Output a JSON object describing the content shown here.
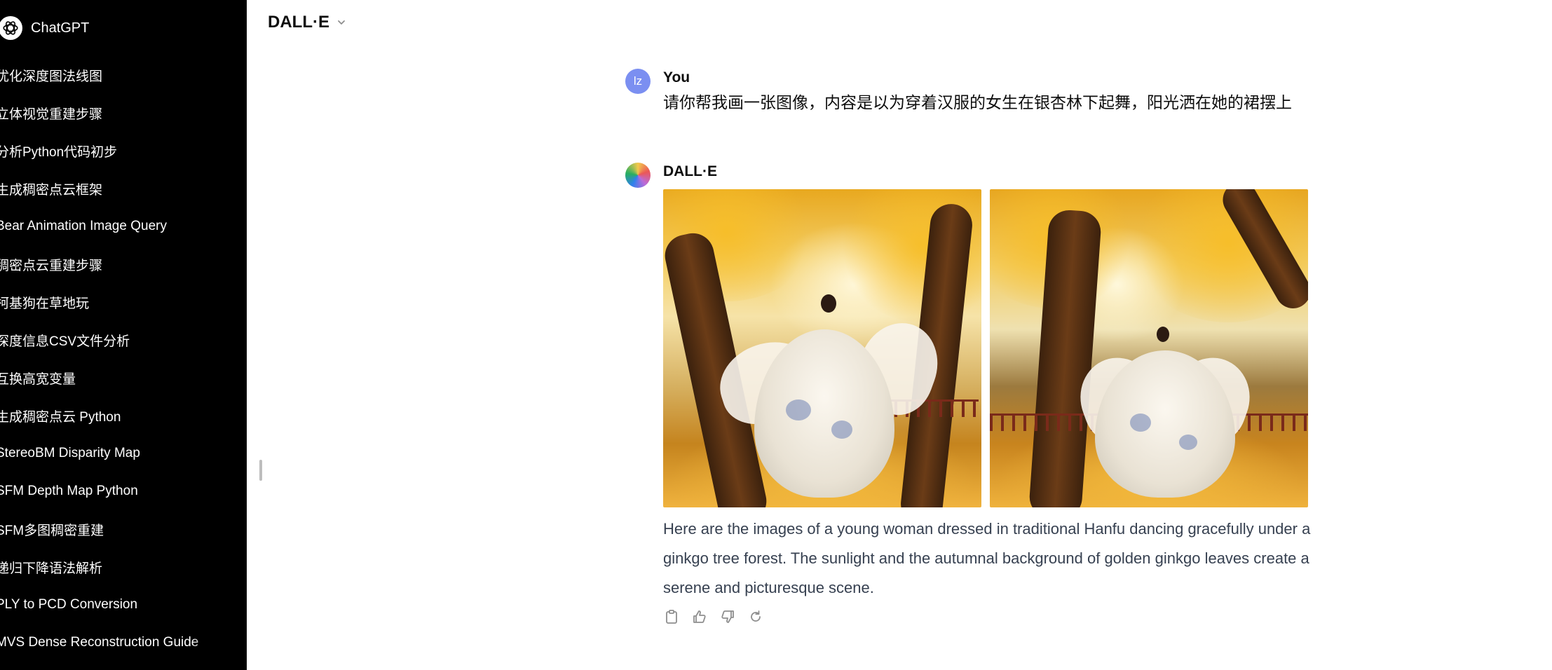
{
  "sidebar": {
    "brand": "ChatGPT",
    "history": [
      "优化深度图法线图",
      "立体视觉重建步骤",
      "分析Python代码初步",
      "生成稠密点云框架",
      "Bear Animation Image Query",
      "稠密点云重建步骤",
      "柯基狗在草地玩",
      "深度信息CSV文件分析",
      "互换高宽变量",
      "生成稠密点云 Python",
      "StereoBM Disparity Map",
      "SFM Depth Map Python",
      "SFM多图稠密重建",
      "递归下降语法解析",
      "PLY to PCD Conversion",
      "MVS Dense Reconstruction Guide"
    ]
  },
  "header": {
    "model": "DALL·E"
  },
  "thread": {
    "user": {
      "avatar_initials": "lz",
      "name": "You",
      "text": "请你帮我画一张图像，内容是以为穿着汉服的女生在银杏林下起舞，阳光洒在她的裙摆上"
    },
    "assistant": {
      "name": "DALL·E",
      "text": "Here are the images of a young woman dressed in traditional Hanfu dancing gracefully under a ginkgo tree forest. The sunlight and the autumnal background of golden ginkgo leaves create a serene and picturesque scene.",
      "images": [
        {
          "icon": "generated-image"
        },
        {
          "icon": "generated-image"
        }
      ],
      "actions": [
        "copy-icon",
        "thumbs-up-icon",
        "thumbs-down-icon",
        "regenerate-icon"
      ]
    }
  },
  "colors": {
    "sidebar_bg": "#000000",
    "user_avatar": "#7b8ff1",
    "assistant_text": "#374151"
  }
}
